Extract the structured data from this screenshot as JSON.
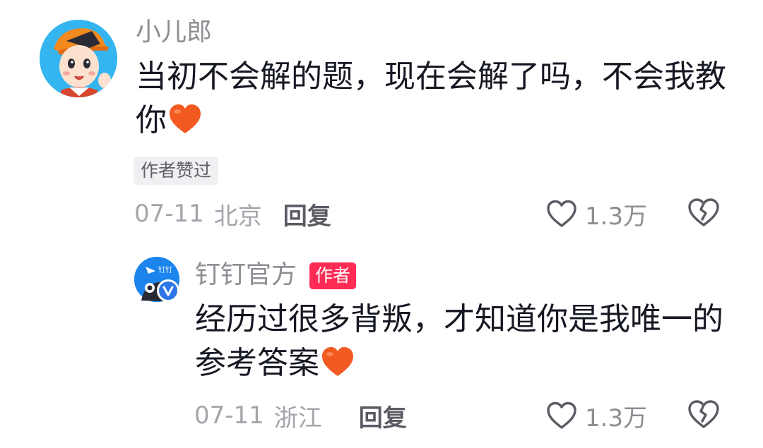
{
  "comment": {
    "username": "小儿郎",
    "text": "当初不会解的题，现在会解了吗，不会我教你",
    "author_liked_label": "作者赞过",
    "date": "07-11",
    "location": "北京",
    "reply_label": "回复",
    "like_count": "1.3万"
  },
  "reply": {
    "username": "钉钉官方",
    "author_badge": "作者",
    "text": "经历过很多背叛，才知道你是我唯一的参考答案",
    "date": "07-11",
    "location": "浙江",
    "reply_label": "回复",
    "like_count": "1.3万"
  },
  "colors": {
    "author_badge_bg": "#fe2c55",
    "text_primary": "#161823",
    "text_secondary": "#8d8d93",
    "heart_emoji": "#f25a22",
    "verify_badge": "#2e76e7"
  },
  "icons": {
    "like": "heart-outline-icon",
    "dislike": "broken-heart-icon",
    "emoji": "orange-heart-emoji",
    "verified": "verified-check-icon"
  }
}
